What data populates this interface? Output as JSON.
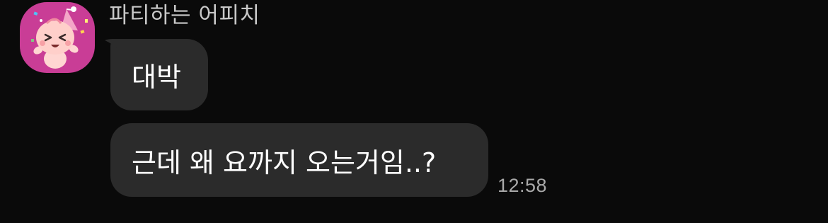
{
  "sender": {
    "name": "파티하는 어피치",
    "avatar_icon": "apeach-party-avatar-icon",
    "avatar_bg": "#c93d96"
  },
  "messages": [
    {
      "text": "대박"
    },
    {
      "text": "근데 왜 요까지 오는거임..?",
      "time": "12:58"
    }
  ],
  "colors": {
    "background": "#0a0a0a",
    "bubble": "#2b2b2b",
    "text": "#ffffff",
    "name": "#c8c8c8",
    "timestamp": "#a9a9a9"
  }
}
